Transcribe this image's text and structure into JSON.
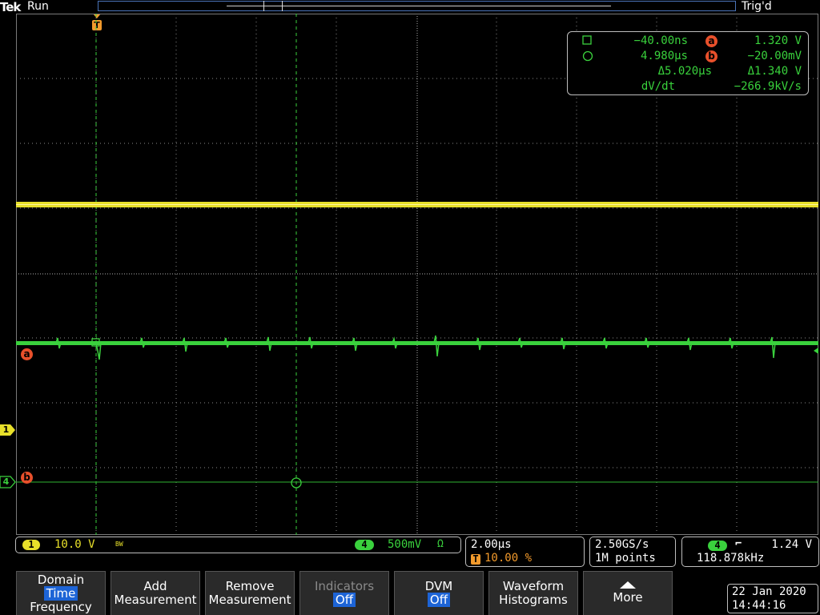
{
  "header": {
    "brand": "Tek",
    "acq_state": "Run",
    "trigger_state": "Trig'd",
    "trigger_marker": "T"
  },
  "cursor_readout": {
    "t1": "−40.00ns",
    "t2": "4.980µs",
    "dt": "Δ5.020µs",
    "va_label": "a",
    "va": "1.320 V",
    "vb_label": "b",
    "vb": "−20.00mV",
    "dv": "Δ1.340 V",
    "dvdt_label": "dV/dt",
    "dvdt": "−266.9kV/s"
  },
  "markers": {
    "cursor_a": "a",
    "cursor_b": "b",
    "ch1": "1",
    "ch4": "4"
  },
  "status": {
    "ch1_num": "1",
    "ch1_scale": "10.0 V",
    "ch1_bw": "BW",
    "ch4_num": "4",
    "ch4_scale": "500mV",
    "ch4_coupling": "Ω",
    "time_scale": "2.00µs",
    "trigger_pos_icon": "T",
    "trigger_pos": "10.00 %",
    "sample_rate": "2.50GS/s",
    "record_length": "1M points",
    "trig_src": "4",
    "trig_slope_icon": "falling-edge-icon",
    "trig_slope": "⌐",
    "trig_level": "1.24 V",
    "frequency": "118.878kHz"
  },
  "menu": {
    "domain_line1": "Domain",
    "domain_sel": "Time",
    "domain_line3": "Frequency",
    "add_1": "Add",
    "add_2": "Measurement",
    "remove_1": "Remove",
    "remove_2": "Measurement",
    "ind_1": "Indicators",
    "ind_2": "Off",
    "dvm_1": "DVM",
    "dvm_2": "Off",
    "wf_1": "Waveform",
    "wf_2": "Histograms",
    "more_icon": "up-arrow-icon",
    "more": "More"
  },
  "datetime": {
    "date": "22 Jan  2020",
    "time": "14:44:16"
  },
  "colors": {
    "ch1": "#e8e02a",
    "ch4": "#3ad13d",
    "cursor": "#e8502b",
    "trigger": "#f29a2c"
  }
}
